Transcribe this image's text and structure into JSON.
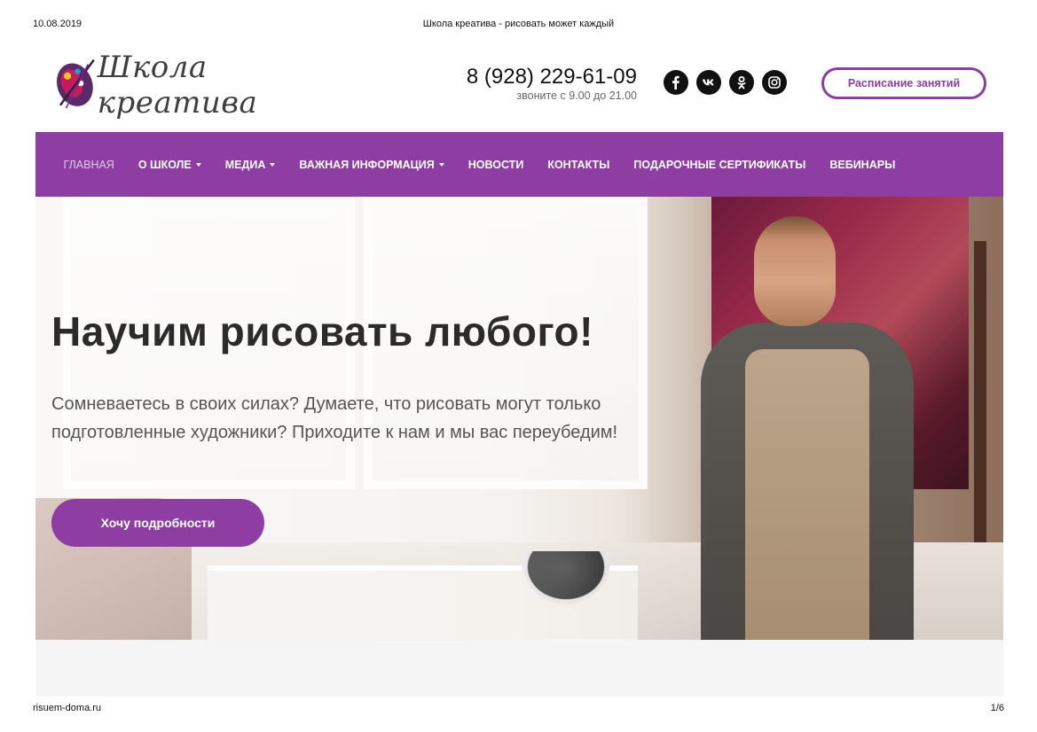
{
  "print": {
    "date": "10.08.2019",
    "title": "Школа креатива - рисовать может каждый",
    "url": "risuem-doma.ru",
    "page": "1/6"
  },
  "header": {
    "logo_text": "Школа креатива",
    "phone": "8 (928) 229-61-09",
    "phone_hours": "звоните с 9.00 до 21.00",
    "socials": [
      {
        "icon": "facebook-icon"
      },
      {
        "icon": "vk-icon"
      },
      {
        "icon": "odnoklassniki-icon"
      },
      {
        "icon": "instagram-icon"
      }
    ],
    "schedule_button": "Расписание занятий"
  },
  "nav": {
    "items": [
      {
        "label": "ГЛАВНАЯ",
        "active": true,
        "dropdown": false
      },
      {
        "label": "О ШКОЛЕ",
        "active": false,
        "dropdown": true
      },
      {
        "label": "МЕДИА",
        "active": false,
        "dropdown": true
      },
      {
        "label": "ВАЖНАЯ ИНФОРМАЦИЯ",
        "active": false,
        "dropdown": true
      },
      {
        "label": "НОВОСТИ",
        "active": false,
        "dropdown": false
      },
      {
        "label": "КОНТАКТЫ",
        "active": false,
        "dropdown": false
      },
      {
        "label": "ПОДАРОЧНЫЕ СЕРТИФИКАТЫ",
        "active": false,
        "dropdown": false
      },
      {
        "label": "ВЕБИНАРЫ",
        "active": false,
        "dropdown": false
      }
    ]
  },
  "hero": {
    "title": "Научим рисовать любого!",
    "subtitle": "Сомневаетесь в своих силах? Думаете, что рисовать могут только подготовленные художники? Приходите к нам и мы вас переубедим!",
    "button": "Хочу подробности"
  },
  "colors": {
    "accent": "#8e3ea2",
    "nav_active": "#e0c8ea"
  }
}
